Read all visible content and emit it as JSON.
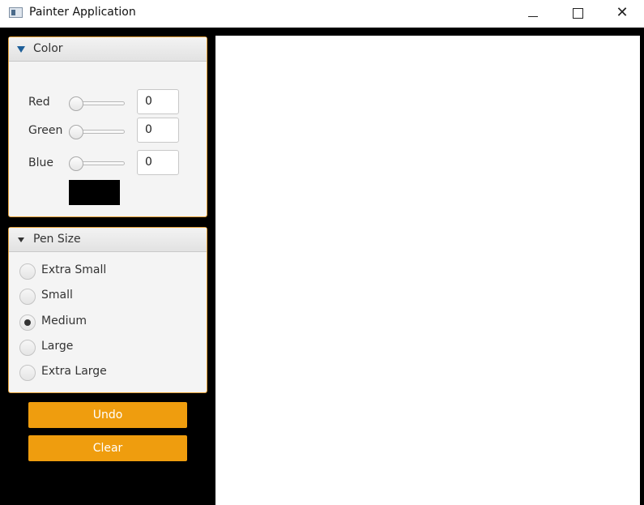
{
  "window": {
    "title": "Painter Application",
    "icon": "app-window-icon",
    "controls": {
      "minimize_icon": "minimize-icon",
      "maximize_icon": "maximize-icon",
      "close_icon": "close-icon",
      "close_glyph": "✕"
    }
  },
  "color_pane": {
    "title": "Color",
    "expanded": true,
    "channels": [
      {
        "label": "Red",
        "value": "0"
      },
      {
        "label": "Green",
        "value": "0"
      },
      {
        "label": "Blue",
        "value": "0"
      }
    ],
    "preview_color": "#000000"
  },
  "pen_pane": {
    "title": "Pen Size",
    "expanded": true,
    "options": [
      {
        "label": "Extra Small",
        "selected": false
      },
      {
        "label": "Small",
        "selected": false
      },
      {
        "label": "Medium",
        "selected": true
      },
      {
        "label": "Large",
        "selected": false
      },
      {
        "label": "Extra Large",
        "selected": false
      }
    ]
  },
  "actions": {
    "undo_label": "Undo",
    "clear_label": "Clear"
  },
  "colors": {
    "accent": "#ef9d0e",
    "panel_border": "#e6a33a",
    "background": "#000000",
    "canvas": "#ffffff"
  }
}
